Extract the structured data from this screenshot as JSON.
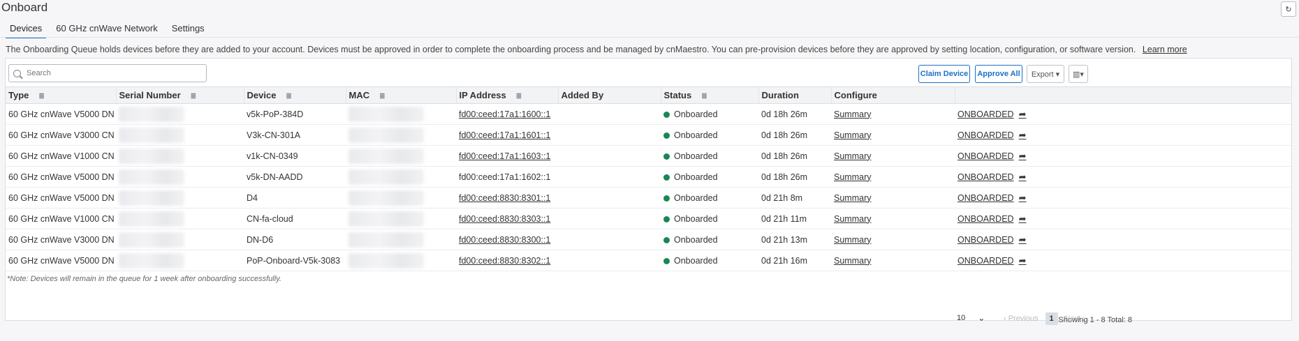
{
  "page": {
    "title": "Onboard",
    "refresh_icon": "refresh-icon"
  },
  "tabs": [
    {
      "label": "Devices",
      "active": true
    },
    {
      "label": "60 GHz cnWave Network",
      "active": false
    },
    {
      "label": "Settings",
      "active": false
    }
  ],
  "info": {
    "text": "The Onboarding Queue holds devices before they are added to your account. Devices must be approved in order to complete the onboarding process and be managed by cnMaestro. You can pre-provision devices before they are approved by setting location, configuration, or software version.",
    "learn_more": "Learn more"
  },
  "toolbar": {
    "search_placeholder": "Search",
    "claim_label": "Claim Device",
    "approve_label": "Approve All",
    "export_label": "Export ▾",
    "columns_icon": "columns-icon"
  },
  "table": {
    "headers": [
      "Type",
      "Serial Number",
      "Device",
      "MAC",
      "IP Address",
      "Added By",
      "Status",
      "Duration",
      "Configure",
      ""
    ],
    "rows": [
      {
        "type": "60 GHz cnWave V5000 DN",
        "device": "v5k-PoP-384D",
        "ip": "fd00:ceed:17a1:1600::1",
        "ip_link": true,
        "status": "Onboarded",
        "duration": "0d 18h 26m",
        "configure": "Summary",
        "action": "ONBOARDED"
      },
      {
        "type": "60 GHz cnWave V3000 CN",
        "device": "V3k-CN-301A",
        "ip": "fd00:ceed:17a1:1601::1",
        "ip_link": true,
        "status": "Onboarded",
        "duration": "0d 18h 26m",
        "configure": "Summary",
        "action": "ONBOARDED"
      },
      {
        "type": "60 GHz cnWave V1000 CN",
        "device": "v1k-CN-0349",
        "ip": "fd00:ceed:17a1:1603::1",
        "ip_link": true,
        "status": "Onboarded",
        "duration": "0d 18h 26m",
        "configure": "Summary",
        "action": "ONBOARDED"
      },
      {
        "type": "60 GHz cnWave V5000 DN",
        "device": "v5k-DN-AADD",
        "ip": "fd00:ceed:17a1:1602::1",
        "ip_link": false,
        "status": "Onboarded",
        "duration": "0d 18h 26m",
        "configure": "Summary",
        "action": "ONBOARDED"
      },
      {
        "type": "60 GHz cnWave V5000 DN",
        "device": "D4",
        "ip": "fd00:ceed:8830:8301::1",
        "ip_link": true,
        "status": "Onboarded",
        "duration": "0d 21h 8m",
        "configure": "Summary",
        "action": "ONBOARDED"
      },
      {
        "type": "60 GHz cnWave V1000 CN",
        "device": "CN-fa-cloud",
        "ip": "fd00:ceed:8830:8303::1",
        "ip_link": true,
        "status": "Onboarded",
        "duration": "0d 21h 11m",
        "configure": "Summary",
        "action": "ONBOARDED"
      },
      {
        "type": "60 GHz cnWave V3000 DN",
        "device": "DN-D6",
        "ip": "fd00:ceed:8830:8300::1",
        "ip_link": true,
        "status": "Onboarded",
        "duration": "0d 21h 13m",
        "configure": "Summary",
        "action": "ONBOARDED"
      },
      {
        "type": "60 GHz cnWave V5000 DN",
        "device": "PoP-Onboard-V5k-3083",
        "ip": "fd00:ceed:8830:8302::1",
        "ip_link": true,
        "status": "Onboarded",
        "duration": "0d 21h 16m",
        "configure": "Summary",
        "action": "ONBOARDED"
      }
    ]
  },
  "footer": {
    "showing": "Showing 1 - 8 Total: 8",
    "page_size": "10",
    "prev": "‹ Previous",
    "page": "1",
    "next": "Next ›"
  },
  "note": "*Note: Devices will remain in the queue for 1 week after onboarding successfully.",
  "colors": {
    "accent": "#1b71c4",
    "status_green": "#198754"
  }
}
